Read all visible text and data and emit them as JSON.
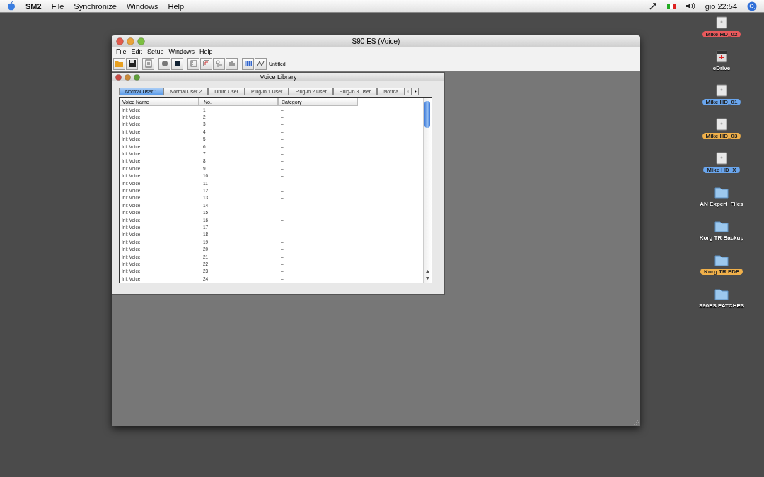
{
  "menubar": {
    "app": "SM2",
    "items": [
      "File",
      "Synchronize",
      "Windows",
      "Help"
    ],
    "clock": "gio 22:54"
  },
  "window": {
    "title": "S90 ES (Voice)",
    "menu": [
      "File",
      "Edit",
      "Setup",
      "Windows",
      "Help"
    ],
    "document": "Untitled"
  },
  "library": {
    "title": "Voice Library",
    "tabs": [
      {
        "label": "Normal User 1",
        "selected": true
      },
      {
        "label": "Normal User 2",
        "selected": false
      },
      {
        "label": "Drum User",
        "selected": false
      },
      {
        "label": "Plug-in 1 User",
        "selected": false
      },
      {
        "label": "Plug-in 2 User",
        "selected": false
      },
      {
        "label": "Plug-in 3 User",
        "selected": false
      },
      {
        "label": "Norma",
        "selected": false
      }
    ],
    "columns": [
      "Voice Name",
      "No.",
      "Category"
    ],
    "rows": [
      [
        "Init Voice",
        "1",
        "–"
      ],
      [
        "Init Voice",
        "2",
        "–"
      ],
      [
        "Init Voice",
        "3",
        "–"
      ],
      [
        "Init Voice",
        "4",
        "–"
      ],
      [
        "Init Voice",
        "5",
        "–"
      ],
      [
        "Init Voice",
        "6",
        "–"
      ],
      [
        "Init Voice",
        "7",
        "–"
      ],
      [
        "Init Voice",
        "8",
        "–"
      ],
      [
        "Init Voice",
        "9",
        "–"
      ],
      [
        "Init Voice",
        "10",
        "–"
      ],
      [
        "Init Voice",
        "11",
        "–"
      ],
      [
        "Init Voice",
        "12",
        "–"
      ],
      [
        "Init Voice",
        "13",
        "–"
      ],
      [
        "Init Voice",
        "14",
        "–"
      ],
      [
        "Init Voice",
        "15",
        "–"
      ],
      [
        "Init Voice",
        "16",
        "–"
      ],
      [
        "Init Voice",
        "17",
        "–"
      ],
      [
        "Init Voice",
        "18",
        "–"
      ],
      [
        "Init Voice",
        "19",
        "–"
      ],
      [
        "Init Voice",
        "20",
        "–"
      ],
      [
        "Init Voice",
        "21",
        "–"
      ],
      [
        "Init Voice",
        "22",
        "–"
      ],
      [
        "Init Voice",
        "23",
        "–"
      ],
      [
        "Init Voice",
        "24",
        "–"
      ]
    ]
  },
  "desktop": [
    {
      "label": "Mike HD_02",
      "kind": "drive",
      "color": "#e8595c"
    },
    {
      "label": "eDrive",
      "kind": "edrive"
    },
    {
      "label": "Mike HD_01",
      "kind": "drive",
      "color": "#6aa6ee"
    },
    {
      "label": "Mike HD_03",
      "kind": "drive",
      "color": "#f0b04a"
    },
    {
      "label": "Mike HD_X",
      "kind": "drive",
      "color": "#6aa6ee"
    },
    {
      "label": "AN Expert  Files",
      "kind": "folder"
    },
    {
      "label": "Korg TR Backup",
      "kind": "folder"
    },
    {
      "label": "Korg TR PDF",
      "kind": "folder",
      "color": "#f0b04a"
    },
    {
      "label": "S90ES PATCHES",
      "kind": "folder"
    }
  ]
}
